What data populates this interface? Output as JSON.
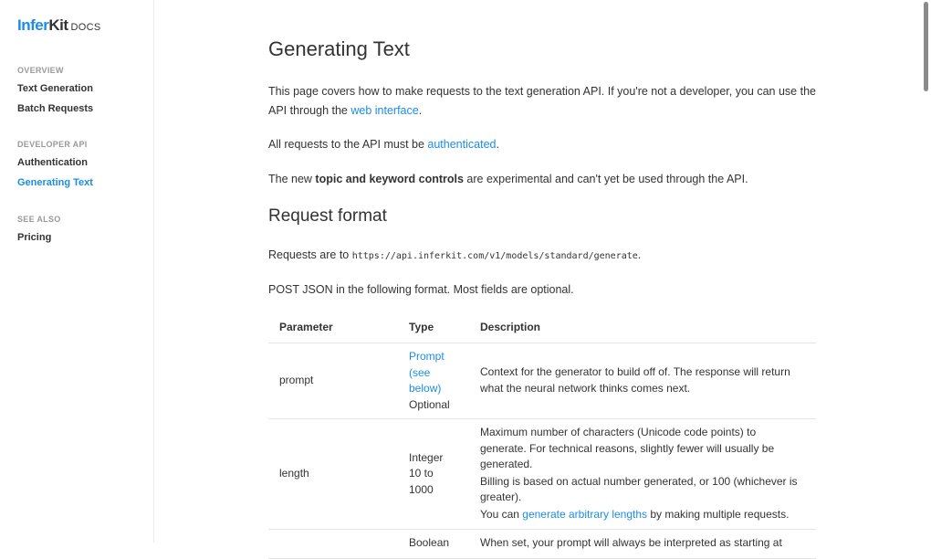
{
  "logo": {
    "infer": "Infer",
    "kit": "Kit",
    "docs": "DOCS"
  },
  "colors": {
    "accent": "#1a8cea",
    "text": "#333333",
    "muted": "#999999"
  },
  "sidebar": {
    "groups": [
      {
        "heading": "OVERVIEW",
        "items": [
          {
            "label": "Text Generation"
          },
          {
            "label": "Batch Requests"
          }
        ]
      },
      {
        "heading": "DEVELOPER API",
        "items": [
          {
            "label": "Authentication"
          },
          {
            "label": "Generating Text",
            "active": true
          }
        ]
      },
      {
        "heading": "SEE ALSO",
        "items": [
          {
            "label": "Pricing"
          }
        ]
      }
    ]
  },
  "main": {
    "title": "Generating Text",
    "intro": {
      "before": "This page covers how to make requests to the text generation API. If you're not a developer, you can use the API through the ",
      "link": "web interface",
      "after": "."
    },
    "auth": {
      "before": "All requests to the API must be ",
      "link": "authenticated",
      "after": "."
    },
    "topic": {
      "before": "The new ",
      "bold": "topic and keyword controls",
      "after": " are experimental and can't yet be used through the API."
    },
    "request_format": {
      "heading": "Request format",
      "url_before": "Requests are to ",
      "url": "https://api.inferkit.com/v1/models/standard/generate",
      "url_after": ".",
      "post": "POST JSON in the following format. Most fields are optional."
    },
    "table": {
      "headers": [
        "Parameter",
        "Type",
        "Description"
      ],
      "rows": [
        {
          "param": "prompt",
          "type_link": "Prompt (see below)",
          "type_extra": "Optional",
          "desc": [
            "Context for the generator to build off of. The response will return what the neural network thinks comes next."
          ]
        },
        {
          "param": "length",
          "type": "Integer 10 to 1000",
          "desc": [
            "Maximum number of characters (Unicode code points) to generate. For technical reasons, slightly fewer will usually be generated.",
            "Billing is based on actual number generated, or 100 (whichever is greater)."
          ],
          "desc_link_before": "You can ",
          "desc_link": "generate arbitrary lengths",
          "desc_link_after": " by making multiple requests."
        },
        {
          "param": "",
          "type": "Boolean",
          "desc": [
            "When set, your prompt will always be interpreted as starting at"
          ]
        }
      ]
    }
  }
}
